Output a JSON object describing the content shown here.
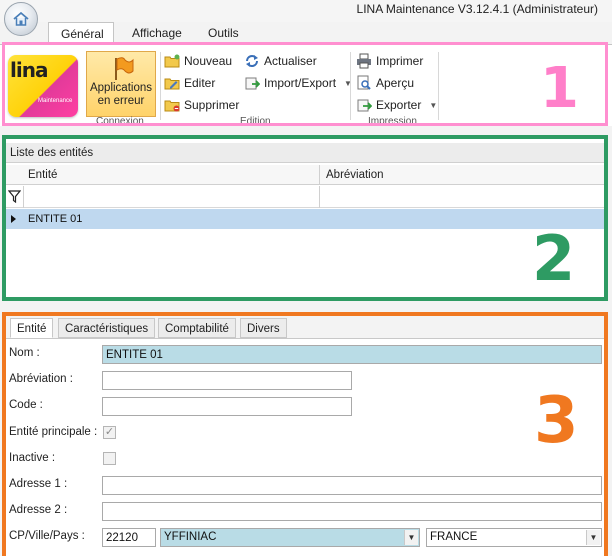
{
  "app_title": "LINA Maintenance  V3.12.4.1  (Administrateur)",
  "ribbon_tabs": [
    {
      "label": "Général",
      "active": true
    },
    {
      "label": "Affichage",
      "active": false
    },
    {
      "label": "Outils",
      "active": false
    }
  ],
  "logo": {
    "word": "lina",
    "tag": "Maintenance"
  },
  "groups": {
    "connexion": {
      "label": "Connexion",
      "button": "Applications en erreur"
    },
    "edition": {
      "label": "Edition",
      "nouveau": "Nouveau",
      "editer": "Editer",
      "supprimer": "Supprimer",
      "actualiser": "Actualiser",
      "import_export": "Import/Export"
    },
    "impression": {
      "label": "Impression",
      "imprimer": "Imprimer",
      "apercu": "Aperçu",
      "exporter": "Exporter"
    }
  },
  "section_numbers": {
    "one": "1",
    "two": "2",
    "three": "3"
  },
  "frame_colors": {
    "one": "#ff8fd0",
    "two": "#2e9b63",
    "three": "#f07820"
  },
  "entity_list": {
    "title": "Liste des entités",
    "columns": [
      "Entité",
      "Abréviation"
    ],
    "rows": [
      {
        "entite": "ENTITE 01",
        "abreviation": ""
      }
    ]
  },
  "detail_tabs": [
    "Entité",
    "Caractéristiques",
    "Comptabilité",
    "Divers"
  ],
  "form": {
    "nom_label": "Nom :",
    "nom_value": "ENTITE 01",
    "abreviation_label": "Abréviation :",
    "abreviation_value": "",
    "code_label": "Code :",
    "code_value": "",
    "entite_principale_label": "Entité principale :",
    "entite_principale_checked": true,
    "inactive_label": "Inactive :",
    "inactive_checked": false,
    "adresse1_label": "Adresse 1 :",
    "adresse1_value": "",
    "adresse2_label": "Adresse 2 :",
    "adresse2_value": "",
    "cp_label": "CP/Ville/Pays :",
    "cp_value": "22120",
    "ville_value": "YFFINIAC",
    "pays_value": "FRANCE"
  }
}
